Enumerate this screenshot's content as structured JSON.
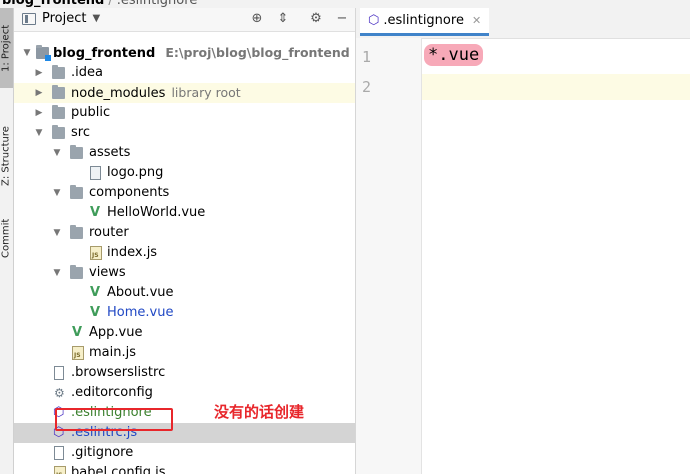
{
  "breadcrumb": {
    "project": "blog_frontend",
    "file": ".eslintignore"
  },
  "tool_stripe": {
    "project_tab": "1: Project",
    "structure_tab": "Z: Structure",
    "commit_tab": "Commit"
  },
  "project_panel": {
    "title": "Project",
    "tree": [
      {
        "label": "blog_frontend",
        "sub": "E:\\proj\\blog\\blog_frontend",
        "icon": "module-folder-icon",
        "bold": true
      },
      {
        "label": ".idea",
        "icon": "folder-icon"
      },
      {
        "label": "node_modules",
        "sub": "library root",
        "icon": "folder-icon"
      },
      {
        "label": "public",
        "icon": "folder-icon"
      },
      {
        "label": "src",
        "icon": "folder-icon"
      },
      {
        "label": "assets",
        "icon": "folder-icon"
      },
      {
        "label": "logo.png",
        "icon": "image-file-icon"
      },
      {
        "label": "components",
        "icon": "folder-icon"
      },
      {
        "label": "HelloWorld.vue",
        "icon": "vue-icon"
      },
      {
        "label": "router",
        "icon": "folder-icon"
      },
      {
        "label": "index.js",
        "icon": "js-file-icon"
      },
      {
        "label": "views",
        "icon": "folder-icon"
      },
      {
        "label": "About.vue",
        "icon": "vue-icon"
      },
      {
        "label": "Home.vue",
        "icon": "vue-icon"
      },
      {
        "label": "App.vue",
        "icon": "vue-icon"
      },
      {
        "label": "main.js",
        "icon": "js-file-icon"
      },
      {
        "label": ".browserslistrc",
        "icon": "text-file-icon"
      },
      {
        "label": ".editorconfig",
        "icon": "gear-icon"
      },
      {
        "label": ".eslintignore",
        "icon": "eslint-icon"
      },
      {
        "label": ".eslintrc.js",
        "icon": "eslint-icon"
      },
      {
        "label": ".gitignore",
        "icon": "git-file-icon"
      },
      {
        "label": "babel.config.js",
        "icon": "js-file-icon"
      }
    ]
  },
  "annotation": "没有的话创建",
  "editor": {
    "tab_label": ".eslintignore",
    "line_numbers": [
      "1",
      "2"
    ],
    "lines": [
      "*.vue",
      ""
    ]
  },
  "colors": {
    "accent_tab": "#4083c9",
    "annotation_red": "#e8262b",
    "vue_green": "#3f9c5a",
    "eslint_purple": "#4b32c3",
    "selection_gray": "#d4d4d4"
  }
}
